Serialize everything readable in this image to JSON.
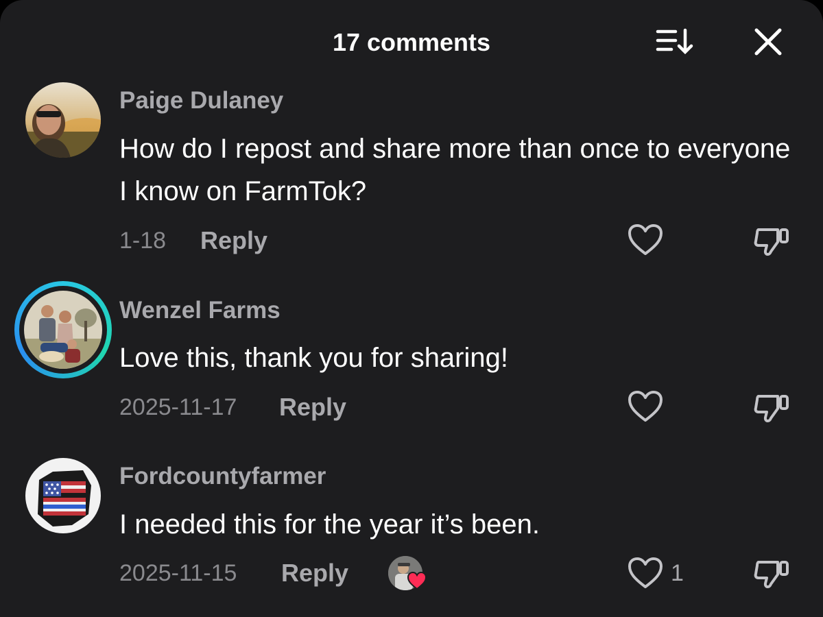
{
  "header": {
    "title": "17 comments",
    "sort_icon": "sort-icon",
    "close_icon": "close-icon"
  },
  "colors": {
    "background": "#1d1d1f",
    "text_primary": "#ffffff",
    "text_secondary": "#a9a9ad",
    "story_ring": "#29c7e4",
    "creator_heart": "#fe2c55"
  },
  "comments": [
    {
      "username": "Paige Dulaney",
      "text": "How do I repost and share more than once to everyone I know on FarmTok?",
      "date": "1-18",
      "reply_label": "Reply",
      "like_count": ""
    },
    {
      "username": "Wenzel Farms",
      "text": "Love this, thank you for sharing!",
      "date": "2025-11-17",
      "reply_label": "Reply",
      "like_count": ""
    },
    {
      "username": "Fordcountyfarmer",
      "text": "I needed this for the year it’s been.",
      "date": "2025-11-15",
      "reply_label": "Reply",
      "like_count": "1",
      "liked_by_creator": true
    }
  ]
}
